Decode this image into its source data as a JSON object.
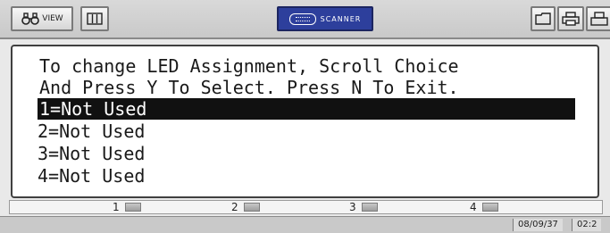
{
  "toolbar": {
    "view_label": "VIEW",
    "scanner_label": "SCANNER"
  },
  "screen": {
    "line1": "To change LED Assignment, Scroll Choice",
    "line2": "And Press Y To Select. Press N To Exit.",
    "options": [
      "1=Not Used",
      "2=Not Used",
      "3=Not Used",
      "4=Not Used"
    ],
    "selected_index": 0
  },
  "led_indicators": [
    "1",
    "2",
    "3",
    "4"
  ],
  "status": {
    "date": "08/09/37",
    "time": "02:2"
  },
  "colors": {
    "scanner_bg": "#2d3f9c",
    "highlight_bg": "#111111",
    "highlight_fg": "#ffffff"
  }
}
